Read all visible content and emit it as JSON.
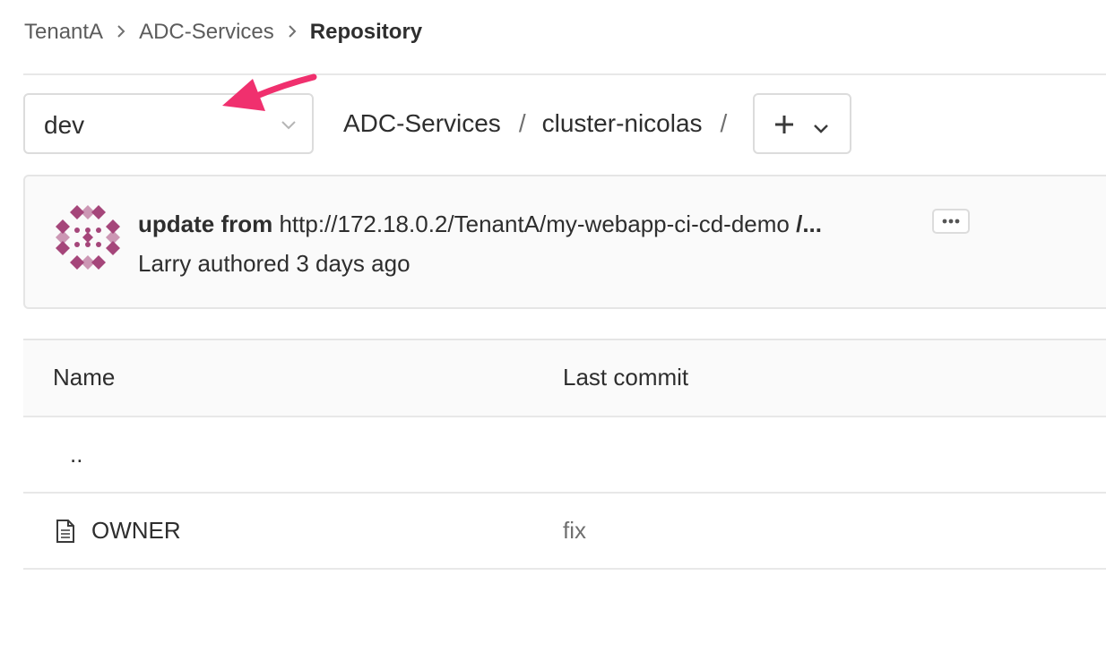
{
  "breadcrumb": {
    "items": [
      "TenantA",
      "ADC-Services"
    ],
    "current": "Repository"
  },
  "branch_selector": {
    "value": "dev"
  },
  "path": {
    "segments": [
      "ADC-Services",
      "cluster-nicolas"
    ],
    "separator": "/"
  },
  "last_commit": {
    "title_bold": "update from",
    "title_rest": " http://172.18.0.2/TenantA/my-webapp-ci-cd-demo ",
    "title_tail": "/...",
    "author_line": "Larry authored 3 days ago"
  },
  "file_table": {
    "columns": [
      "Name",
      "Last commit"
    ],
    "parent_row": "..",
    "rows": [
      {
        "name": "OWNER",
        "last_commit": "fix"
      }
    ]
  },
  "colors": {
    "arrow": "#f0306e",
    "avatar": "#a5467a",
    "text": "#2e2e2e",
    "muted": "#707070"
  },
  "icons": [
    "chevron-right-icon",
    "chevron-down-icon",
    "plus-icon",
    "ellipsis-icon",
    "file-icon",
    "arrow-annotation"
  ]
}
